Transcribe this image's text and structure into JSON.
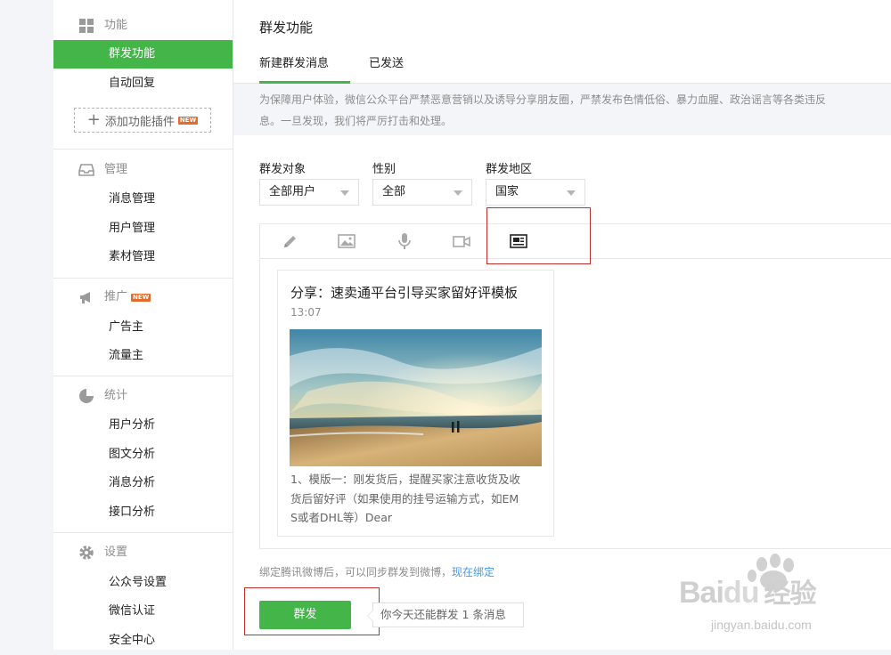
{
  "sidebar": {
    "groups": [
      {
        "title": "功能",
        "icon": "grid-icon",
        "items": [
          "群发功能",
          "自动回复"
        ],
        "add_plugin_label": "添加功能插件",
        "badge": "NEW"
      },
      {
        "title": "管理",
        "icon": "inbox-icon",
        "items": [
          "消息管理",
          "用户管理",
          "素材管理"
        ]
      },
      {
        "title": "推广",
        "icon": "megaphone-icon",
        "badge": "NEW",
        "items": [
          "广告主",
          "流量主"
        ]
      },
      {
        "title": "统计",
        "icon": "pie-chart-icon",
        "items": [
          "用户分析",
          "图文分析",
          "消息分析",
          "接口分析"
        ]
      },
      {
        "title": "设置",
        "icon": "gear-icon",
        "items": [
          "公众号设置",
          "微信认证",
          "安全中心"
        ]
      }
    ],
    "active_item": "群发功能"
  },
  "main": {
    "page_title": "群发功能",
    "tabs": [
      {
        "label": "新建群发消息",
        "active": true
      },
      {
        "label": "已发送",
        "active": false
      }
    ],
    "notice_line1": "为保障用户体验，微信公众平台严禁恶意营销以及诱导分享朋友圈，严禁发布色情低俗、暴力血腥、政治谣言等各类违反",
    "notice_line2": "息。一旦发现，我们将严厉打击和处理。",
    "filters": {
      "target": {
        "label": "群发对象",
        "value": "全部用户"
      },
      "gender": {
        "label": "性别",
        "value": "全部"
      },
      "region": {
        "label": "群发地区",
        "value": "国家"
      }
    },
    "toolbar_icons": [
      "pencil-icon",
      "image-icon",
      "microphone-icon",
      "video-icon",
      "news-icon"
    ],
    "card": {
      "title": "分享：速卖通平台引导买家留好评模板",
      "time": "13:07",
      "desc_line1": "1、模版一：刚发货后，提醒买家注意收货及收",
      "desc_line2": "货后留好评（如果使用的挂号运输方式，如EM",
      "desc_line3": "S或者DHL等）Dear"
    },
    "bind_hint": "绑定腾讯微博后，可以同步群发到微博，",
    "bind_link": "现在绑定",
    "send_button": "群发",
    "send_tip": "你今天还能群发 1 条消息"
  },
  "watermark": {
    "brand": "Bai",
    "brand2": "du",
    "cn": "经验",
    "url": "jingyan.baidu.com"
  },
  "colors": {
    "accent": "#44b549",
    "link": "#459ae9",
    "highlight": "#c0312e"
  }
}
